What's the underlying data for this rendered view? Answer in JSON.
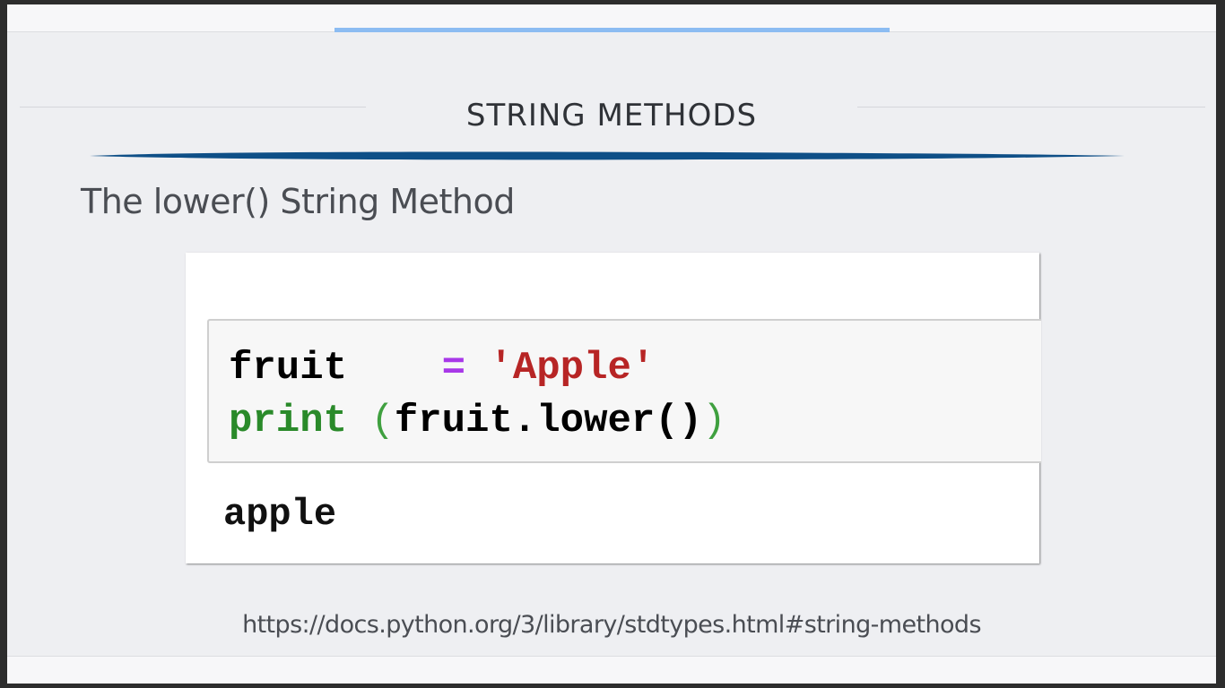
{
  "slide": {
    "title": "STRING METHODS",
    "subtitle": "The lower() String Method",
    "url": "https://docs.python.org/3/library/stdtypes.html#string-methods"
  },
  "code": {
    "line1": {
      "var": "fruit",
      "spaces": "   ",
      "op": "=",
      "value": "'Apple'"
    },
    "line2": {
      "keyword": "print",
      "open_paren": "(",
      "call": "fruit.lower()",
      "close_paren": ")"
    },
    "output": "apple"
  },
  "colors": {
    "accent_bar": "#8cbcf2",
    "swoosh": "#0e4f87",
    "string_literal": "#b72525",
    "operator": "#a838e8",
    "keyword": "#2a8a2a"
  }
}
